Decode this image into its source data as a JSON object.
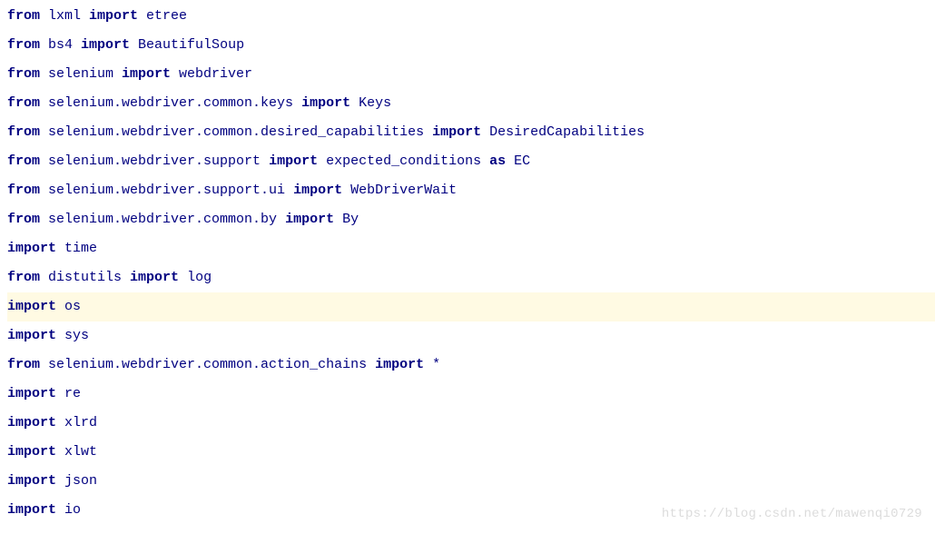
{
  "code": {
    "lines": [
      {
        "tokens": [
          [
            "kw",
            "from"
          ],
          [
            "txt",
            " lxml "
          ],
          [
            "kw",
            "import"
          ],
          [
            "txt",
            " etree"
          ]
        ]
      },
      {
        "tokens": [
          [
            "kw",
            "from"
          ],
          [
            "txt",
            " bs4 "
          ],
          [
            "kw",
            "import"
          ],
          [
            "txt",
            " BeautifulSoup"
          ]
        ]
      },
      {
        "tokens": [
          [
            "kw",
            "from"
          ],
          [
            "txt",
            " selenium "
          ],
          [
            "kw",
            "import"
          ],
          [
            "txt",
            " webdriver"
          ]
        ]
      },
      {
        "tokens": [
          [
            "kw",
            "from"
          ],
          [
            "txt",
            " selenium.webdriver.common.keys "
          ],
          [
            "kw",
            "import"
          ],
          [
            "txt",
            " Keys"
          ]
        ]
      },
      {
        "tokens": [
          [
            "kw",
            "from"
          ],
          [
            "txt",
            " selenium.webdriver.common.desired_capabilities "
          ],
          [
            "kw",
            "import"
          ],
          [
            "txt",
            " DesiredCapabilities"
          ]
        ]
      },
      {
        "tokens": [
          [
            "kw",
            "from"
          ],
          [
            "txt",
            " selenium.webdriver.support "
          ],
          [
            "kw",
            "import"
          ],
          [
            "txt",
            " expected_conditions "
          ],
          [
            "kw",
            "as"
          ],
          [
            "txt",
            " EC"
          ]
        ]
      },
      {
        "tokens": [
          [
            "kw",
            "from"
          ],
          [
            "txt",
            " selenium.webdriver.support.ui "
          ],
          [
            "kw",
            "import"
          ],
          [
            "txt",
            " WebDriverWait"
          ]
        ]
      },
      {
        "tokens": [
          [
            "kw",
            "from"
          ],
          [
            "txt",
            " selenium.webdriver.common.by "
          ],
          [
            "kw",
            "import"
          ],
          [
            "txt",
            " By"
          ]
        ]
      },
      {
        "tokens": [
          [
            "kw",
            "import"
          ],
          [
            "txt",
            " time"
          ]
        ]
      },
      {
        "tokens": [
          [
            "kw",
            "from"
          ],
          [
            "txt",
            " distutils "
          ],
          [
            "kw",
            "import"
          ],
          [
            "txt",
            " log"
          ]
        ]
      },
      {
        "highlighted": true,
        "tokens": [
          [
            "kw",
            "import"
          ],
          [
            "txt",
            " os"
          ]
        ]
      },
      {
        "tokens": [
          [
            "kw",
            "import"
          ],
          [
            "txt",
            " sys"
          ]
        ]
      },
      {
        "tokens": [
          [
            "kw",
            "from"
          ],
          [
            "txt",
            " selenium.webdriver.common.action_chains "
          ],
          [
            "kw",
            "import"
          ],
          [
            "txt",
            " *"
          ]
        ]
      },
      {
        "tokens": [
          [
            "kw",
            "import"
          ],
          [
            "txt",
            " re"
          ]
        ]
      },
      {
        "tokens": [
          [
            "kw",
            "import"
          ],
          [
            "txt",
            " xlrd"
          ]
        ]
      },
      {
        "tokens": [
          [
            "kw",
            "import"
          ],
          [
            "txt",
            " xlwt"
          ]
        ]
      },
      {
        "tokens": [
          [
            "kw",
            "import"
          ],
          [
            "txt",
            " json"
          ]
        ]
      },
      {
        "tokens": [
          [
            "kw",
            "import"
          ],
          [
            "txt",
            " io"
          ]
        ]
      }
    ]
  },
  "watermark": "https://blog.csdn.net/mawenqi0729"
}
